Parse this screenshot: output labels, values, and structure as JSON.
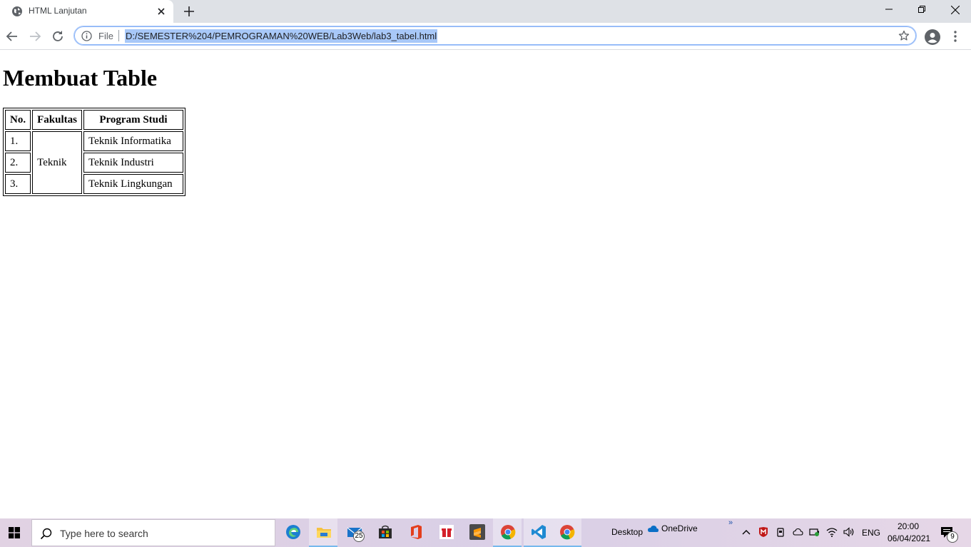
{
  "browser": {
    "tab": {
      "title": "HTML Lanjutan"
    },
    "address_bar": {
      "scheme_label": "File",
      "url": "D:/SEMESTER%204/PEMROGRAMAN%20WEB/Lab3Web/lab3_tabel.html"
    }
  },
  "page": {
    "heading": "Membuat Table",
    "table": {
      "headers": [
        "No.",
        "Fakultas",
        "Program Studi"
      ],
      "fakultas": "Teknik",
      "rows": [
        {
          "no": "1.",
          "program": "Teknik Informatika"
        },
        {
          "no": "2.",
          "program": "Teknik Industri"
        },
        {
          "no": "3.",
          "program": "Teknik Lingkungan"
        }
      ]
    }
  },
  "taskbar": {
    "search_placeholder": "Type here to search",
    "mail_badge": "25",
    "desktop_label": "Desktop",
    "onedrive_label": "OneDrive",
    "overflow_label": "»",
    "language": "ENG",
    "time": "20:00",
    "date": "06/04/2021",
    "notification_count": "9",
    "apps": [
      "edge-icon",
      "file-explorer-icon",
      "mail-icon",
      "store-icon",
      "office-icon",
      "gift-icon",
      "sublime-text-icon",
      "chrome-icon",
      "vscode-icon",
      "chrome-active-icon"
    ]
  },
  "colors": {
    "tab_strip": "#dee1e6",
    "url_highlight": "#a8c8f8",
    "taskbar": "#dcd0e5"
  }
}
